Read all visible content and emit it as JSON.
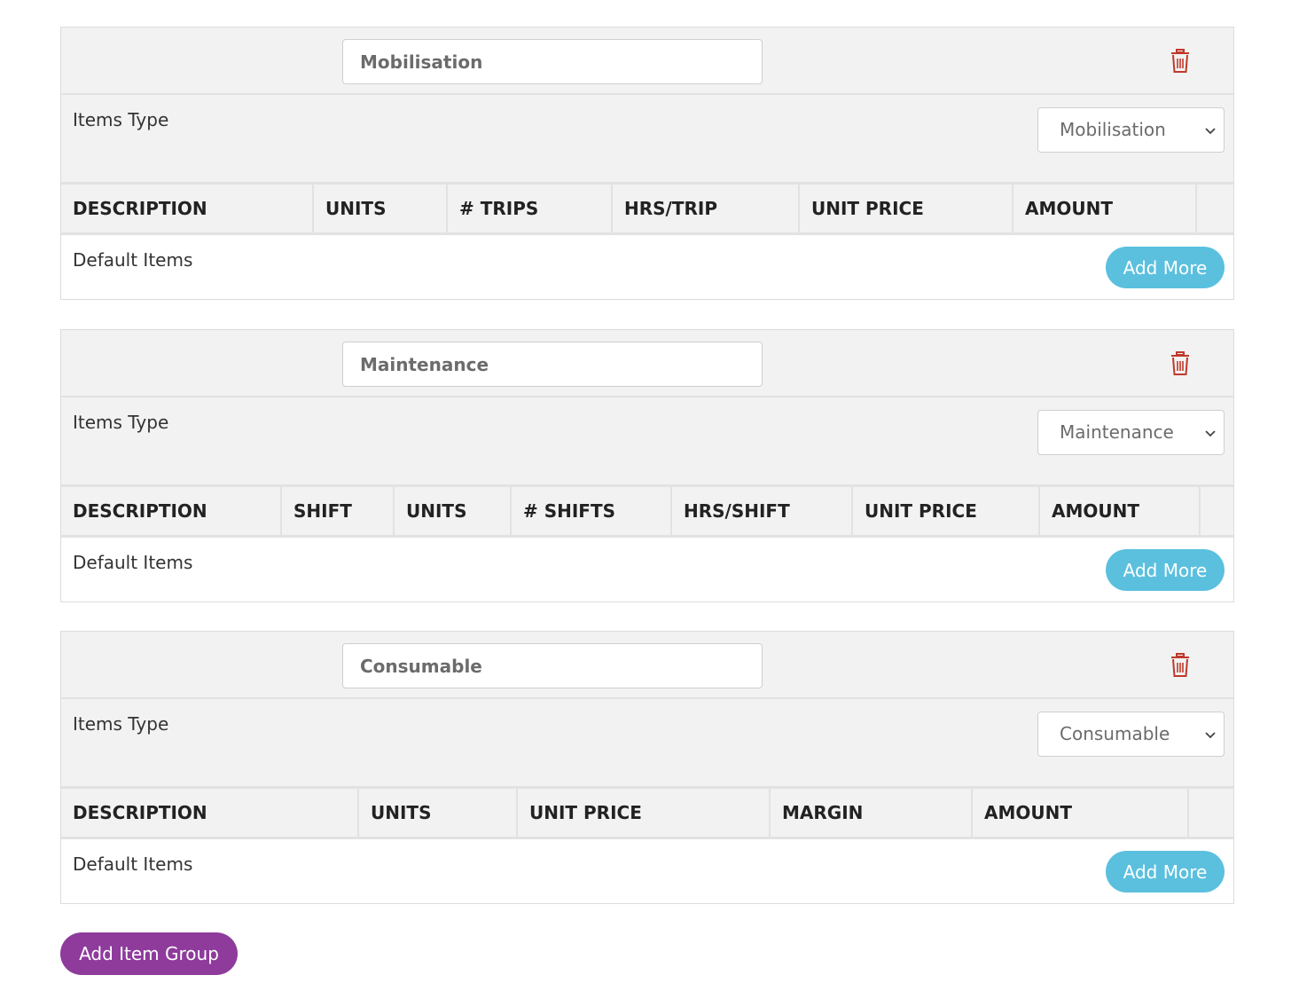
{
  "groups": [
    {
      "name_value": "Mobilisation",
      "items_type_label": "Items Type",
      "items_type_selected": "Mobilisation",
      "columns": [
        "DESCRIPTION",
        "UNITS",
        "# TRIPS",
        "HRS/TRIP",
        "UNIT PRICE",
        "AMOUNT",
        ""
      ],
      "default_items_label": "Default Items",
      "add_more_label": "Add More"
    },
    {
      "name_value": "Maintenance",
      "items_type_label": "Items Type",
      "items_type_selected": "Maintenance",
      "columns": [
        "DESCRIPTION",
        "SHIFT",
        "UNITS",
        "# SHIFTS",
        "HRS/SHIFT",
        "UNIT PRICE",
        "AMOUNT",
        ""
      ],
      "default_items_label": "Default Items",
      "add_more_label": "Add More"
    },
    {
      "name_value": "Consumable",
      "items_type_label": "Items Type",
      "items_type_selected": "Consumable",
      "columns": [
        "DESCRIPTION",
        "UNITS",
        "UNIT PRICE",
        "MARGIN",
        "AMOUNT",
        ""
      ],
      "default_items_label": "Default Items",
      "add_more_label": "Add More"
    }
  ],
  "add_item_group_label": "Add Item Group",
  "icons": {
    "delete": "trash-icon",
    "select": "chevron-down-icon"
  },
  "colors": {
    "delete_icon": "#c0392b",
    "add_more": "#5bc0de",
    "add_item_group": "#8e3b9c"
  }
}
